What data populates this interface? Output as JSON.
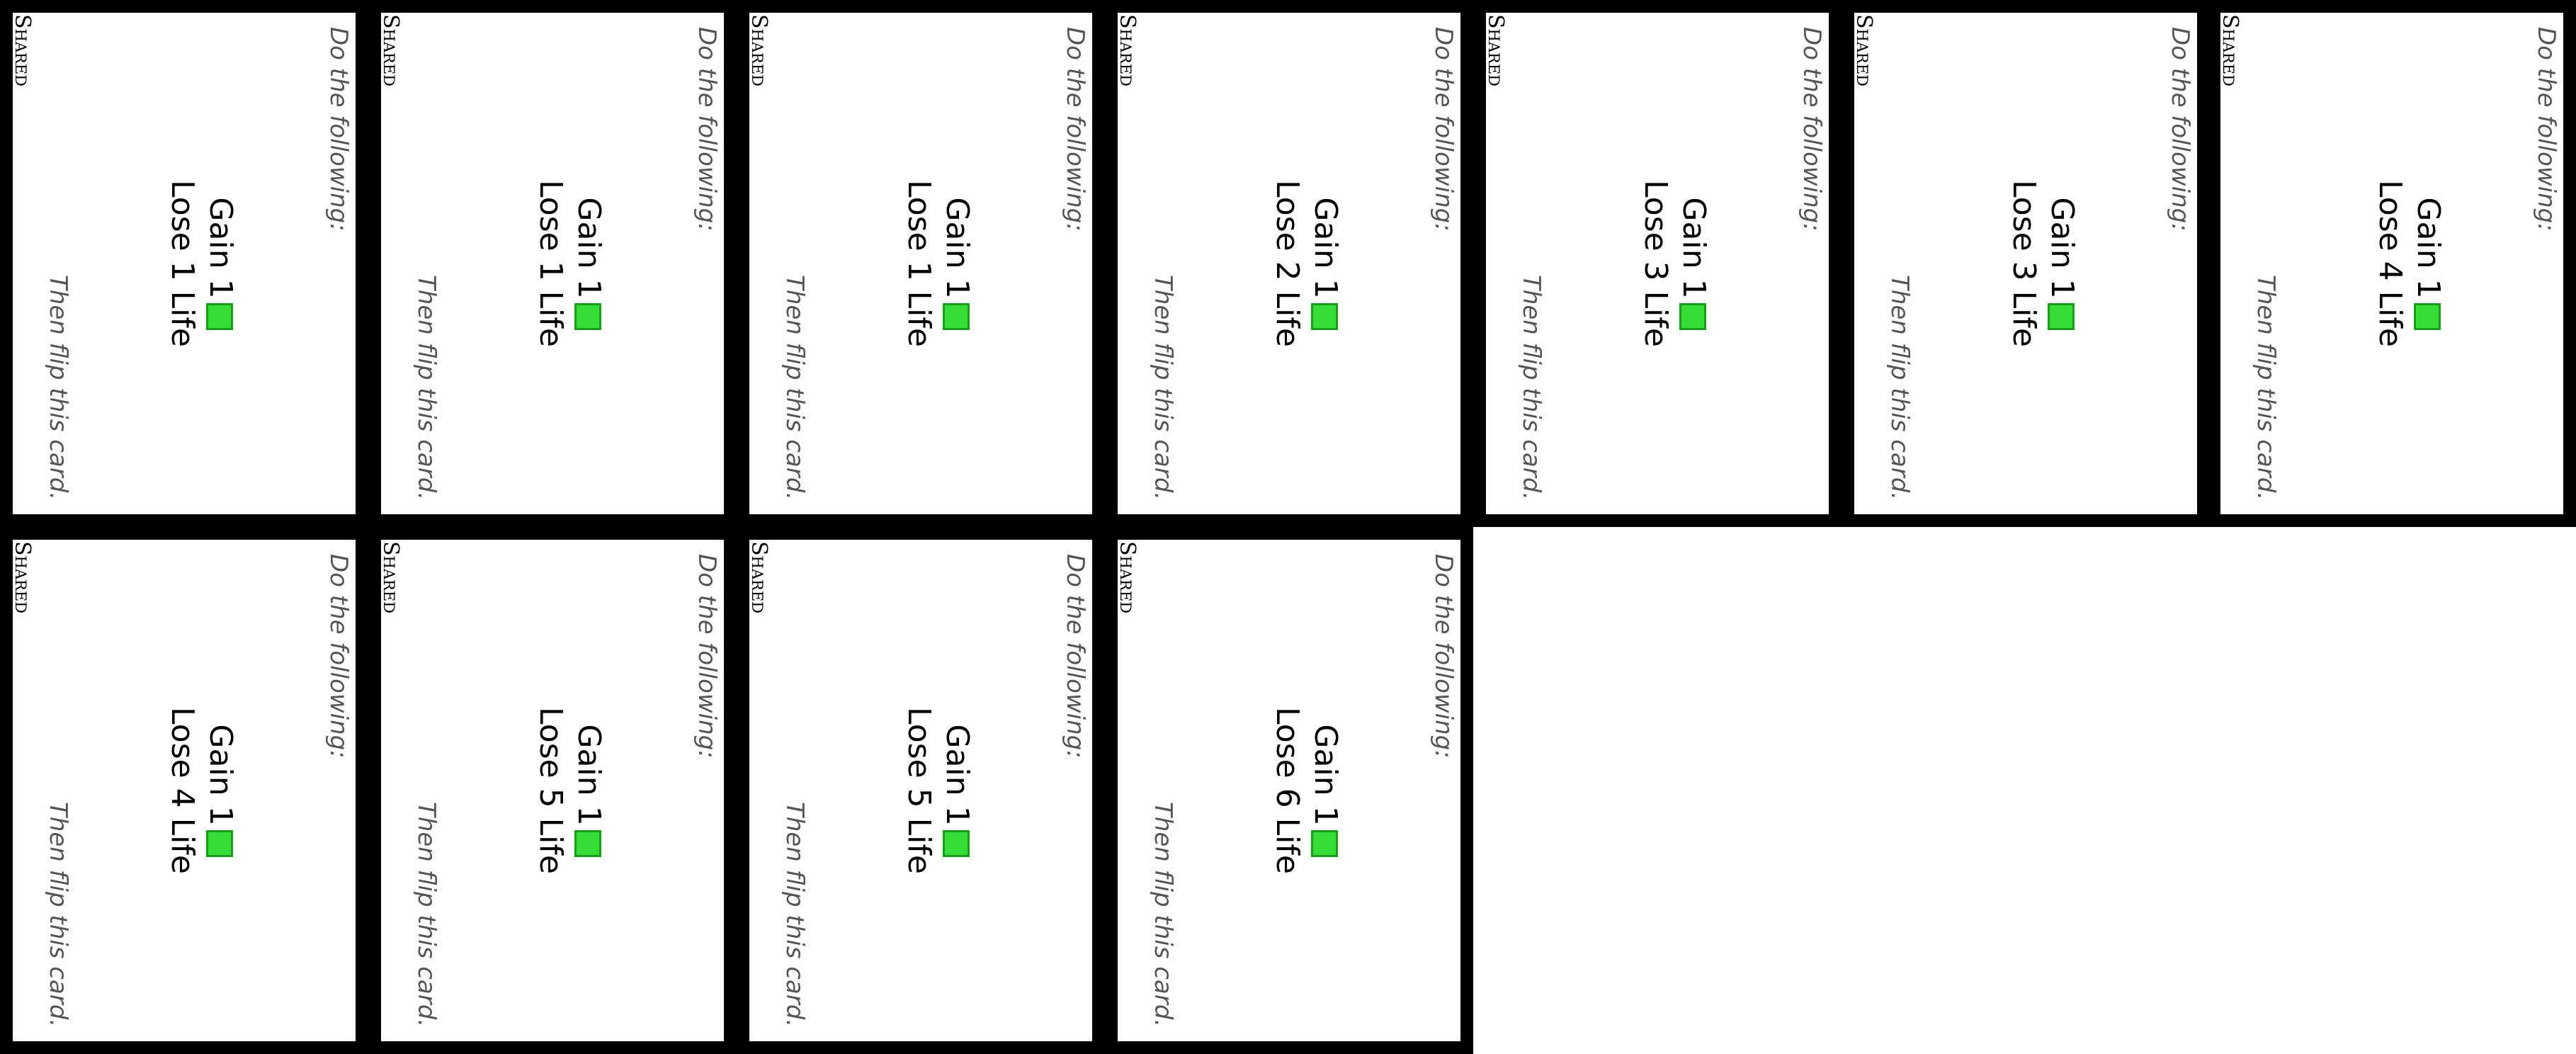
{
  "cards": [
    {
      "label": "Shared",
      "intro": "Do the following:",
      "gain_text": "Gain 1",
      "gain_icon": "green-square-icon",
      "lose_text": "Lose 1 Life",
      "outro": "Then flip this card."
    },
    {
      "label": "Shared",
      "intro": "Do the following:",
      "gain_text": "Gain 1",
      "gain_icon": "green-square-icon",
      "lose_text": "Lose 1 Life",
      "outro": "Then flip this card."
    },
    {
      "label": "Shared",
      "intro": "Do the following:",
      "gain_text": "Gain 1",
      "gain_icon": "green-square-icon",
      "lose_text": "Lose 1 Life",
      "outro": "Then flip this card."
    },
    {
      "label": "Shared",
      "intro": "Do the following:",
      "gain_text": "Gain 1",
      "gain_icon": "green-square-icon",
      "lose_text": "Lose 2 Life",
      "outro": "Then flip this card."
    },
    {
      "label": "Shared",
      "intro": "Do the following:",
      "gain_text": "Gain 1",
      "gain_icon": "green-square-icon",
      "lose_text": "Lose 3 Life",
      "outro": "Then flip this card."
    },
    {
      "label": "Shared",
      "intro": "Do the following:",
      "gain_text": "Gain 1",
      "gain_icon": "green-square-icon",
      "lose_text": "Lose 3 Life",
      "outro": "Then flip this card."
    },
    {
      "label": "Shared",
      "intro": "Do the following:",
      "gain_text": "Gain 1",
      "gain_icon": "green-square-icon",
      "lose_text": "Lose 4 Life",
      "outro": "Then flip this card."
    },
    {
      "label": "Shared",
      "intro": "Do the following:",
      "gain_text": "Gain 1",
      "gain_icon": "green-square-icon",
      "lose_text": "Lose 4 Life",
      "outro": "Then flip this card."
    },
    {
      "label": "Shared",
      "intro": "Do the following:",
      "gain_text": "Gain 1",
      "gain_icon": "green-square-icon",
      "lose_text": "Lose 5 Life",
      "outro": "Then flip this card."
    },
    {
      "label": "Shared",
      "intro": "Do the following:",
      "gain_text": "Gain 1",
      "gain_icon": "green-square-icon",
      "lose_text": "Lose 5 Life",
      "outro": "Then flip this card."
    },
    {
      "label": "Shared",
      "intro": "Do the following:",
      "gain_text": "Gain 1",
      "gain_icon": "green-square-icon",
      "lose_text": "Lose 6 Life",
      "outro": "Then flip this card."
    }
  ],
  "colors": {
    "card_border": "#000000",
    "card_face": "#ffffff",
    "gain_icon_fill": "#33dd33",
    "gain_icon_border": "#1b9a1b",
    "italic_text": "#555555"
  }
}
